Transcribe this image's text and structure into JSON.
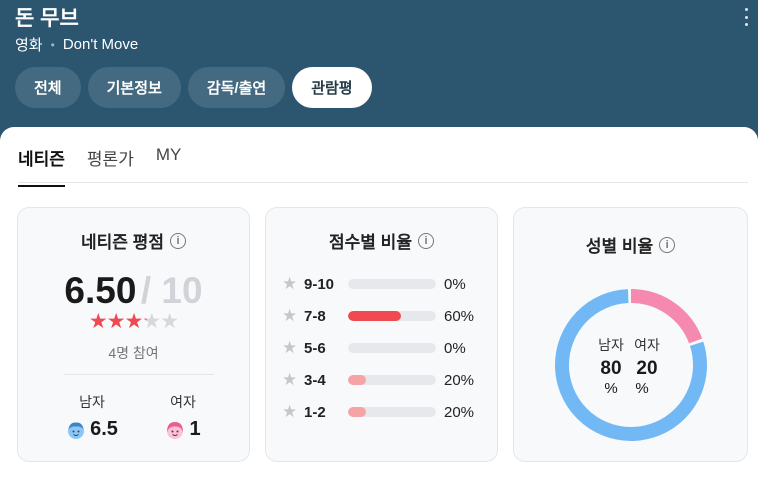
{
  "header": {
    "title": "돈 무브",
    "category": "영화",
    "english_title": "Don't Move",
    "tabs": [
      "전체",
      "기본정보",
      "감독/출연",
      "관람평"
    ],
    "active_tab": 3
  },
  "subtabs": [
    "네티즌",
    "평론가",
    "MY"
  ],
  "rating_card": {
    "title": "네티즌 평점",
    "score": "6.50",
    "out_of": "/ 10",
    "stars_value": 3.25,
    "stars_max": 5,
    "count_text": "4명 참여",
    "male": {
      "label": "남자",
      "value": "6.5",
      "icon": "male-face-icon"
    },
    "female": {
      "label": "여자",
      "value": "1",
      "icon": "female-face-icon"
    }
  },
  "distribution_card": {
    "title": "점수별 비율",
    "rows": [
      {
        "label": "9-10",
        "value": 0,
        "pct": "0%",
        "color": "#e6e8eb"
      },
      {
        "label": "7-8",
        "value": 60,
        "pct": "60%",
        "color": "#f04a50"
      },
      {
        "label": "5-6",
        "value": 0,
        "pct": "0%",
        "color": "#e6e8eb"
      },
      {
        "label": "3-4",
        "value": 20,
        "pct": "20%",
        "color": "#f5a3a6"
      },
      {
        "label": "1-2",
        "value": 20,
        "pct": "20%",
        "color": "#f5a3a6"
      }
    ]
  },
  "gender_card": {
    "title": "성별 비율",
    "male_label": "남자",
    "female_label": "여자",
    "male_value": "80",
    "female_value": "20",
    "unit": "%",
    "male_fraction": 0.8,
    "female_fraction": 0.2,
    "male_color": "#72b8f5",
    "female_color": "#f589b0"
  }
}
